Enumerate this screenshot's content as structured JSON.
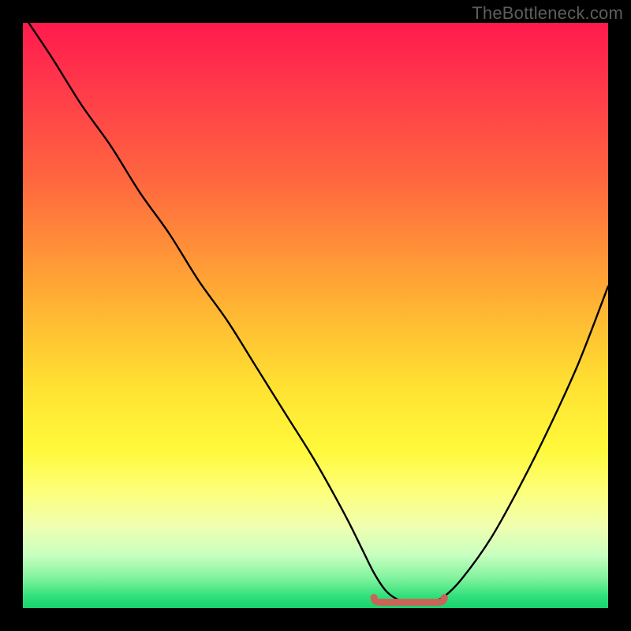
{
  "watermark": "TheBottleneck.com",
  "colors": {
    "curve_stroke": "#000000",
    "marker_stroke": "#c96458",
    "frame_bg": "#000000"
  },
  "chart_data": {
    "type": "line",
    "title": "",
    "xlabel": "",
    "ylabel": "",
    "xlim": [
      0,
      100
    ],
    "ylim": [
      0,
      100
    ],
    "grid": false,
    "legend": false,
    "series": [
      {
        "name": "bottleneck-curve",
        "x": [
          1,
          5,
          10,
          15,
          20,
          25,
          30,
          35,
          40,
          45,
          50,
          55,
          58,
          60,
          62,
          64,
          66,
          68,
          70,
          72,
          75,
          80,
          85,
          90,
          95,
          100
        ],
        "y": [
          100,
          94,
          86,
          79,
          71,
          64,
          56,
          49,
          41,
          33,
          25,
          16,
          10,
          6,
          3,
          1.5,
          1,
          1,
          1.2,
          2,
          5,
          12,
          21,
          31,
          42,
          55
        ]
      }
    ],
    "marker": {
      "name": "optimal-range",
      "x_start": 60,
      "x_end": 72,
      "y": 1
    }
  }
}
